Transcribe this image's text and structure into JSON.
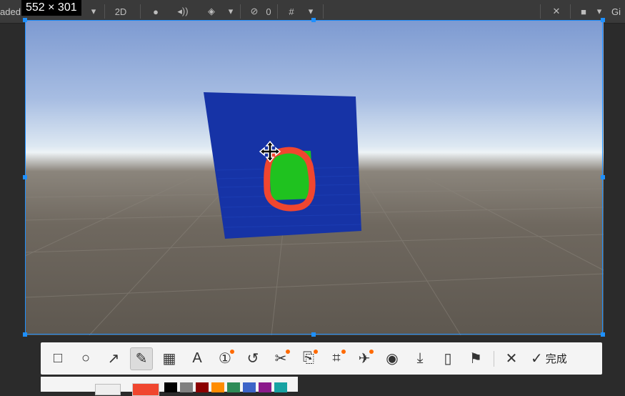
{
  "unity_toolbar": {
    "left_fragment": "aded",
    "mode_2d": "2D",
    "hidden_count": "0",
    "right_fragment": "Gi",
    "icons": [
      "dropdown-icon",
      "light-bulb-icon",
      "audio-icon",
      "effects-icon",
      "visibility-icon",
      "grid-snap-icon",
      "tools-icon",
      "camera-icon"
    ]
  },
  "selection": {
    "size_label": "552 × 301"
  },
  "annotation_toolbar": {
    "tools": [
      {
        "name": "rectangle-tool",
        "glyph": "□"
      },
      {
        "name": "ellipse-tool",
        "glyph": "○"
      },
      {
        "name": "arrow-tool",
        "glyph": "↗"
      },
      {
        "name": "pen-tool",
        "glyph": "✎",
        "active": true
      },
      {
        "name": "mosaic-tool",
        "glyph": "▦"
      },
      {
        "name": "text-tool",
        "glyph": "A"
      },
      {
        "name": "number-tool",
        "glyph": "①",
        "dot": true
      },
      {
        "name": "undo-tool",
        "glyph": "↺"
      },
      {
        "name": "scissors-tool",
        "glyph": "✂",
        "dot": true
      },
      {
        "name": "ocr-tool",
        "glyph": "⎘",
        "dot": true
      },
      {
        "name": "translate-tool",
        "glyph": "⌗",
        "dot": true
      },
      {
        "name": "pin-tool",
        "glyph": "✈",
        "dot": true
      },
      {
        "name": "record-tool",
        "glyph": "◉"
      },
      {
        "name": "download-tool",
        "glyph": "⤓"
      },
      {
        "name": "phone-tool",
        "glyph": "▯"
      },
      {
        "name": "bookmark-tool",
        "glyph": "⚑"
      }
    ],
    "cancel_glyph": "✕",
    "done_glyph": "✓",
    "done_label": "完成"
  },
  "palette": {
    "current_color": "#f0462f",
    "swatches": [
      "#000000",
      "#808080",
      "#8b0000",
      "#ff8c00",
      "#2e8b57",
      "#3c64c8",
      "#8b1a8b",
      "#17a2a2"
    ]
  },
  "scene_colors": {
    "panel": "#1633a6",
    "panel_dark": "#0f2a96",
    "green": "#1fc21f",
    "annotation": "#f0462f"
  }
}
